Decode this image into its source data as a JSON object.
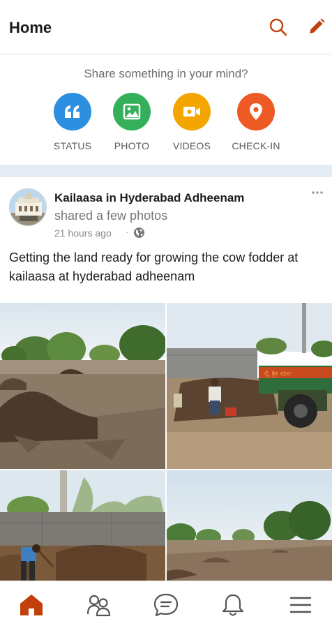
{
  "header": {
    "title": "Home",
    "search_icon": "search-icon",
    "edit_icon": "pencil-icon"
  },
  "share": {
    "prompt": "Share something in your mind?",
    "buttons": [
      {
        "label": "STATUS",
        "icon": "quote-icon",
        "color": "#2d8fe0"
      },
      {
        "label": "PHOTO",
        "icon": "photo-icon",
        "color": "#34b05a"
      },
      {
        "label": "VIDEOS",
        "icon": "video-camera-icon",
        "color": "#f5a500"
      },
      {
        "label": "CHECK-IN",
        "icon": "location-pin-icon",
        "color": "#ee5a24"
      }
    ]
  },
  "post": {
    "author": "Kailaasa in Hyderabad Adheenam",
    "action": "shared a few photos",
    "time": "21 hours ago",
    "separator": "·",
    "privacy_icon": "globe-icon",
    "more_icon": "more-dots-icon",
    "text": "Getting the land ready for growing the cow fodder at kailaasa at hyderabad adheenam",
    "photos": [
      {
        "icon": "field-photo"
      },
      {
        "icon": "tractor-photo"
      },
      {
        "icon": "worker-photo"
      },
      {
        "icon": "trees-photo"
      }
    ]
  },
  "bottom_nav": {
    "items": [
      {
        "icon": "home-icon",
        "active": true
      },
      {
        "icon": "groups-icon",
        "active": false
      },
      {
        "icon": "chat-icon",
        "active": false
      },
      {
        "icon": "bell-icon",
        "active": false
      },
      {
        "icon": "menu-icon",
        "active": false
      }
    ]
  },
  "colors": {
    "accent": "#c2400d",
    "divider": "#e6ecf3"
  }
}
